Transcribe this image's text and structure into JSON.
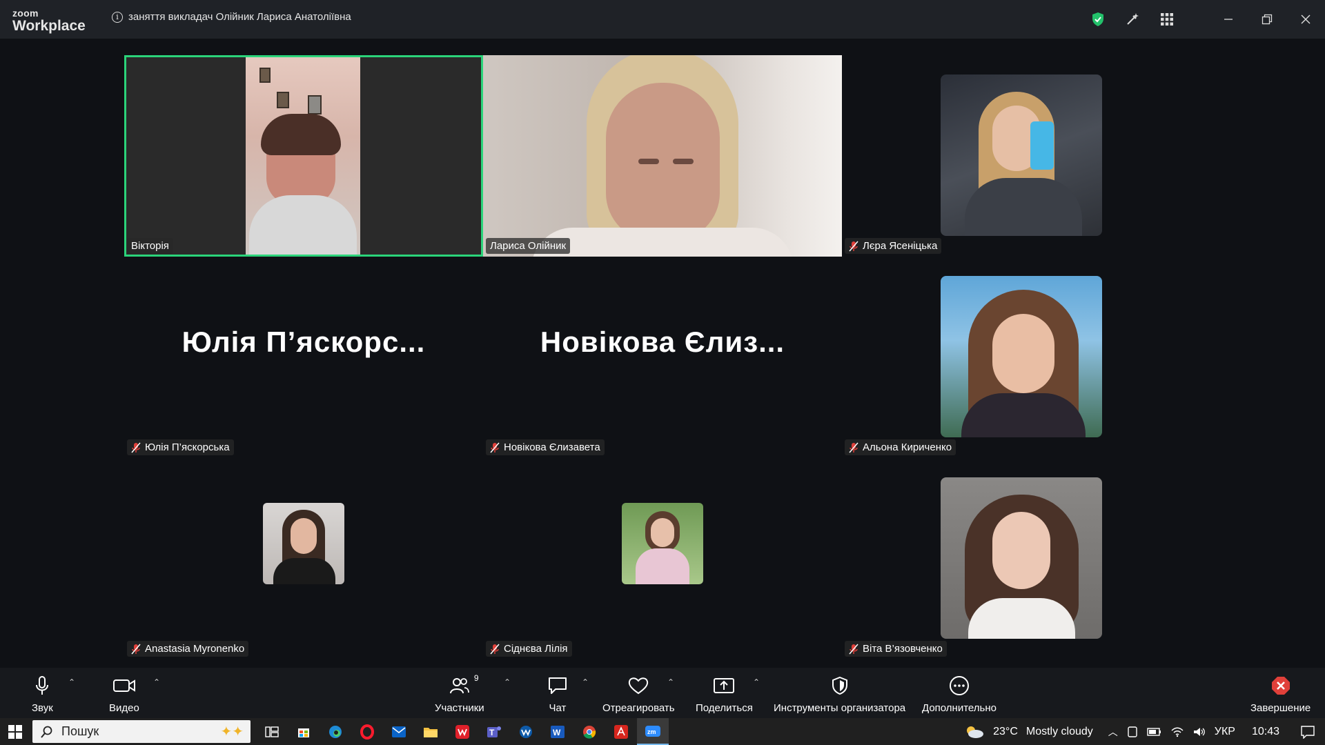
{
  "app": {
    "logo_line1": "zoom",
    "logo_line2": "Workplace",
    "meeting_title": "заняття викладач  Олійник Лариса Анатоліївна"
  },
  "participants": [
    {
      "name": "Вікторія",
      "muted": false,
      "active_speaker": true,
      "video": "camera"
    },
    {
      "name": "Лариса Олійник",
      "muted": false,
      "active_speaker": false,
      "video": "camera"
    },
    {
      "name": "Лєра Ясеніцька",
      "muted": true,
      "video": "photo"
    },
    {
      "name": "Юлія П’яскорська",
      "display_name_big": "Юлія  П’яскорс...",
      "muted": true,
      "video": "off"
    },
    {
      "name": "Новікова Єлизавета",
      "display_name_big": "Новікова Єлиз...",
      "muted": true,
      "video": "off"
    },
    {
      "name": "Альона Кириченко",
      "muted": true,
      "video": "photo"
    },
    {
      "name": "Anastasia Myronenko",
      "muted": true,
      "video": "avatar"
    },
    {
      "name": "Сіднєва Лілія",
      "muted": true,
      "video": "avatar"
    },
    {
      "name": "Віта В’язовченко",
      "muted": true,
      "video": "photo"
    }
  ],
  "toolbar": {
    "audio": "Звук",
    "video": "Видео",
    "participants": "Участники",
    "participants_count": "9",
    "chat": "Чат",
    "react": "Отреагировать",
    "share": "Поделиться",
    "host_tools": "Инструменты организатора",
    "more": "Дополнительно",
    "end": "Завершение"
  },
  "taskbar": {
    "search_placeholder": "Пошук",
    "weather_temp": "23°C",
    "weather_text": "Mostly cloudy",
    "language": "УКР",
    "time": "10:43"
  },
  "colors": {
    "active_speaker_border": "#2bd47a",
    "mute_red": "#e0403a",
    "end_red": "#e0403a",
    "shield_green": "#23c16b"
  }
}
